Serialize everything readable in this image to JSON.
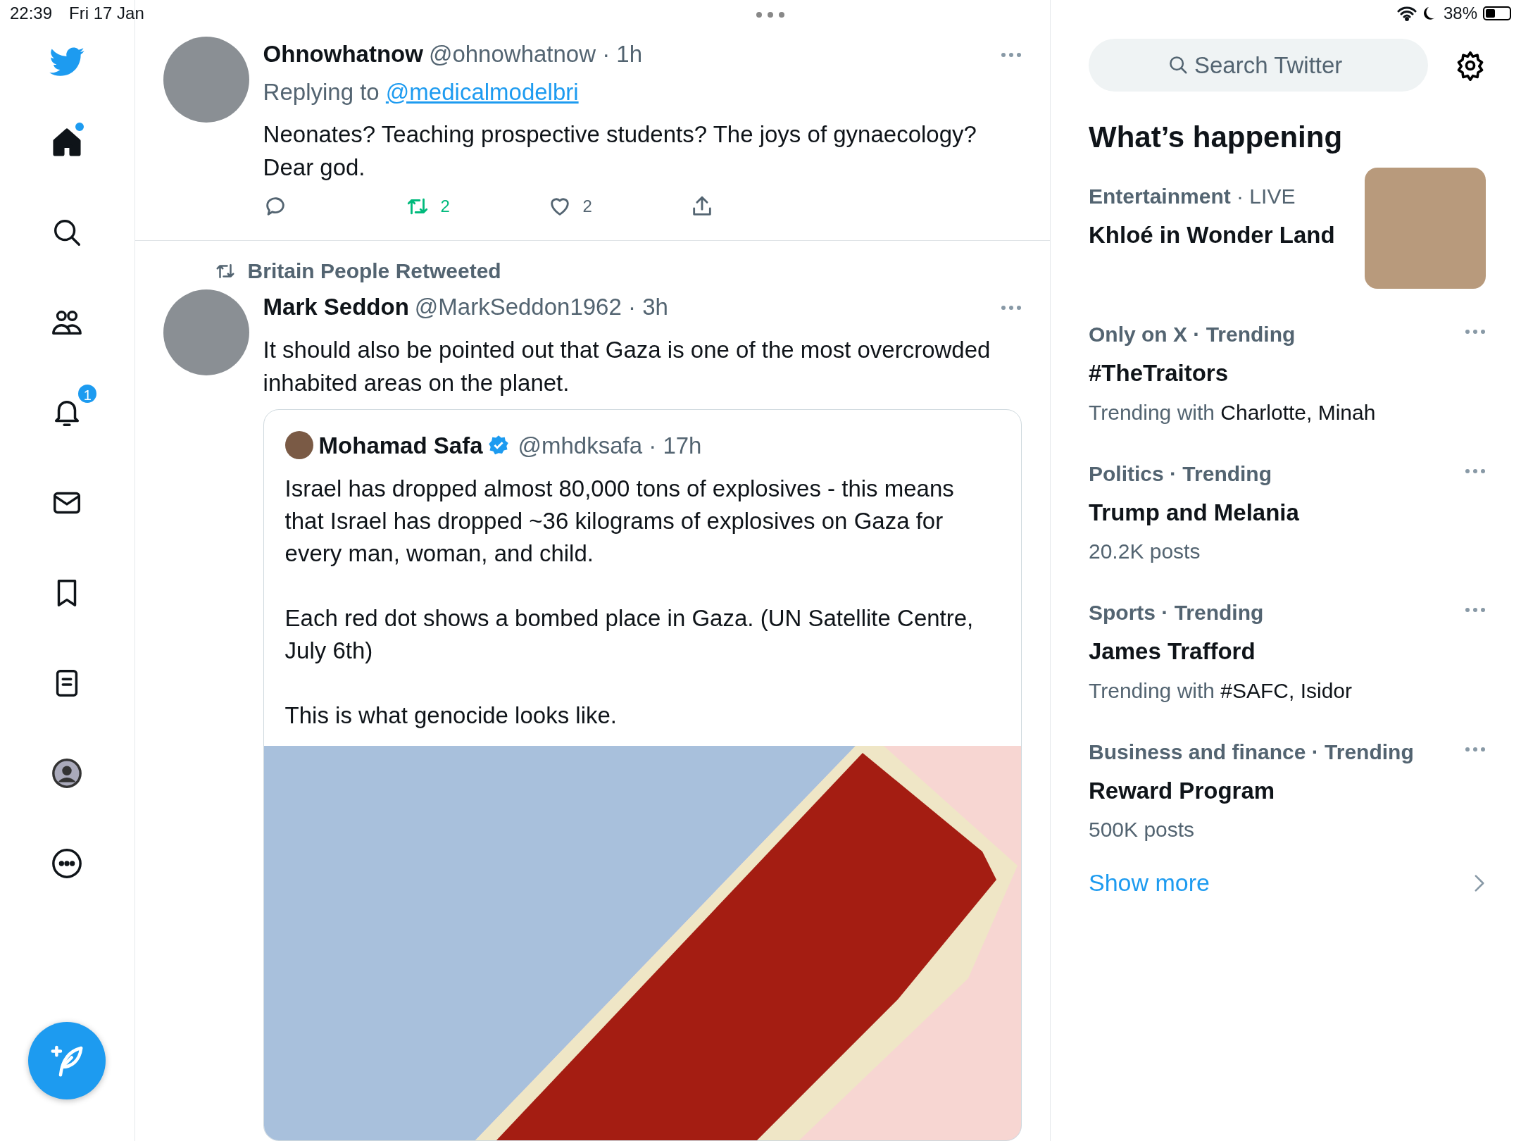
{
  "status_bar": {
    "time": "22:39",
    "date": "Fri 17 Jan",
    "battery": "38%"
  },
  "sidebar": {
    "items": [
      {
        "kind": "home",
        "selected": true,
        "unread": true
      },
      {
        "kind": "search",
        "selected": false,
        "unread": false
      },
      {
        "kind": "communities",
        "selected": false,
        "unread": false
      },
      {
        "kind": "notifications",
        "selected": false,
        "unread": false,
        "badge": "1"
      },
      {
        "kind": "messages",
        "selected": false,
        "unread": false
      },
      {
        "kind": "bookmarks",
        "selected": false,
        "unread": false
      },
      {
        "kind": "lists",
        "selected": false,
        "unread": false
      },
      {
        "kind": "profile",
        "selected": false,
        "unread": false
      },
      {
        "kind": "more",
        "selected": false,
        "unread": false
      }
    ]
  },
  "tweets": [
    {
      "author": "Ohnowhatnow",
      "meta": "@ohnowhatnow · 1h",
      "reply_prefix": "Replying to",
      "reply_to": "@medicalmodelbri",
      "text": "Neonates? Teaching prospective students? The joys of gynaecology? Dear god.",
      "actions": [
        {
          "kind": "reply",
          "active": false
        },
        {
          "kind": "retweet",
          "count": "2",
          "active": true
        },
        {
          "kind": "like",
          "count": "2",
          "active": false
        },
        {
          "kind": "share",
          "active": false
        }
      ]
    },
    {
      "retweeted_by": "Britain People Retweeted",
      "author": "Mark Seddon",
      "meta": "@MarkSeddon1962 · 3h",
      "text": "It should also be pointed out that Gaza is one of the most overcrowded inhabited areas on the planet.",
      "quote": {
        "author": "Mohamad Safa",
        "verified": true,
        "meta": "@mhdksafa · 17h",
        "paragraphs": [
          "Israel has dropped almost 80,000 tons of explosives - this means that Israel has dropped ~36 kilograms of explosives on Gaza for every man, woman, and child.",
          "Each red dot shows a bombed place in Gaza. (UN Satellite Centre, July 6th)",
          "This is what genocide looks like."
        ]
      }
    }
  ],
  "search": {
    "placeholder": "Search Twitter"
  },
  "trends_heading": "What’s happening",
  "trends": [
    {
      "context": "**Entertainment** · LIVE",
      "name": "Khloé in Wonder Land",
      "has_image": true
    },
    {
      "context": "Only on X · Trending",
      "name": "#TheTraitors",
      "detail": "Trending with",
      "detail_names": "Charlotte, Minah"
    },
    {
      "context": "Politics · Trending",
      "name": "Trump and Melania",
      "detail": "20.2K posts"
    },
    {
      "context": "Sports · Trending",
      "name": "James Trafford",
      "detail": "Trending with",
      "detail_names": "#SAFC, Isidor"
    },
    {
      "context": "Business and finance · Trending",
      "name": "Reward Program",
      "detail": "500K posts"
    }
  ],
  "show_more": "Show more"
}
